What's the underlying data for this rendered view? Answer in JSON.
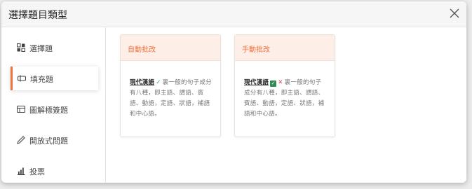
{
  "dialog": {
    "title": "選擇題目類型"
  },
  "sidebar": {
    "items": [
      {
        "label": "選擇題",
        "icon": "grid-icon"
      },
      {
        "label": "填充題",
        "icon": "fill-blank-icon"
      },
      {
        "label": "圖解標簽題",
        "icon": "image-label-icon"
      },
      {
        "label": "開放式問題",
        "icon": "pencil-icon"
      },
      {
        "label": "投票",
        "icon": "bar-chart-icon"
      }
    ],
    "active_index": 1
  },
  "cards": [
    {
      "title": "自動批改",
      "keyword": "現代漢語",
      "mark": "✓",
      "text": "裏一般的句子成分有八種，即主語、謂語、賓語、動語，定語、狀語，補語和中心語。"
    },
    {
      "title": "手動批改",
      "keyword": "現代漢語",
      "mark": "✓",
      "mark2": "✕",
      "text": "裏一般的句子成分有八種，即主語、謂語、賓語、動語，定語、狀語，補語和中心語。"
    }
  ],
  "colors": {
    "accent": "#f0733f",
    "card_header": "#fdeee8"
  }
}
